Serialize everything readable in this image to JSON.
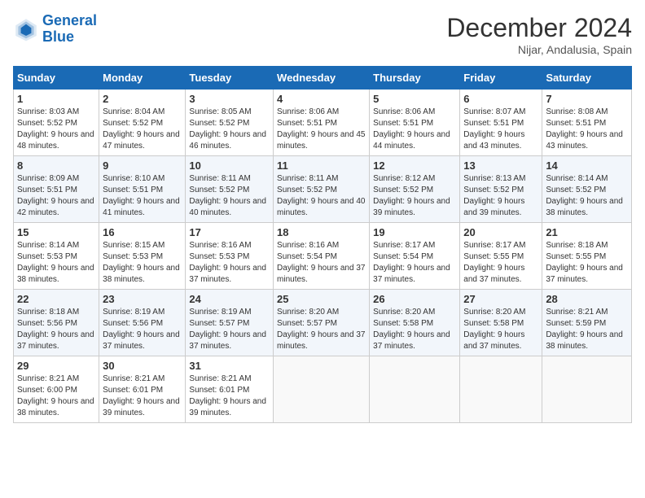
{
  "header": {
    "logo_line1": "General",
    "logo_line2": "Blue",
    "title": "December 2024",
    "subtitle": "Nijar, Andalusia, Spain"
  },
  "days_of_week": [
    "Sunday",
    "Monday",
    "Tuesday",
    "Wednesday",
    "Thursday",
    "Friday",
    "Saturday"
  ],
  "weeks": [
    [
      {
        "day": "1",
        "info": "Sunrise: 8:03 AM\nSunset: 5:52 PM\nDaylight: 9 hours and 48 minutes."
      },
      {
        "day": "2",
        "info": "Sunrise: 8:04 AM\nSunset: 5:52 PM\nDaylight: 9 hours and 47 minutes."
      },
      {
        "day": "3",
        "info": "Sunrise: 8:05 AM\nSunset: 5:52 PM\nDaylight: 9 hours and 46 minutes."
      },
      {
        "day": "4",
        "info": "Sunrise: 8:06 AM\nSunset: 5:51 PM\nDaylight: 9 hours and 45 minutes."
      },
      {
        "day": "5",
        "info": "Sunrise: 8:06 AM\nSunset: 5:51 PM\nDaylight: 9 hours and 44 minutes."
      },
      {
        "day": "6",
        "info": "Sunrise: 8:07 AM\nSunset: 5:51 PM\nDaylight: 9 hours and 43 minutes."
      },
      {
        "day": "7",
        "info": "Sunrise: 8:08 AM\nSunset: 5:51 PM\nDaylight: 9 hours and 43 minutes."
      }
    ],
    [
      {
        "day": "8",
        "info": "Sunrise: 8:09 AM\nSunset: 5:51 PM\nDaylight: 9 hours and 42 minutes."
      },
      {
        "day": "9",
        "info": "Sunrise: 8:10 AM\nSunset: 5:51 PM\nDaylight: 9 hours and 41 minutes."
      },
      {
        "day": "10",
        "info": "Sunrise: 8:11 AM\nSunset: 5:52 PM\nDaylight: 9 hours and 40 minutes."
      },
      {
        "day": "11",
        "info": "Sunrise: 8:11 AM\nSunset: 5:52 PM\nDaylight: 9 hours and 40 minutes."
      },
      {
        "day": "12",
        "info": "Sunrise: 8:12 AM\nSunset: 5:52 PM\nDaylight: 9 hours and 39 minutes."
      },
      {
        "day": "13",
        "info": "Sunrise: 8:13 AM\nSunset: 5:52 PM\nDaylight: 9 hours and 39 minutes."
      },
      {
        "day": "14",
        "info": "Sunrise: 8:14 AM\nSunset: 5:52 PM\nDaylight: 9 hours and 38 minutes."
      }
    ],
    [
      {
        "day": "15",
        "info": "Sunrise: 8:14 AM\nSunset: 5:53 PM\nDaylight: 9 hours and 38 minutes."
      },
      {
        "day": "16",
        "info": "Sunrise: 8:15 AM\nSunset: 5:53 PM\nDaylight: 9 hours and 38 minutes."
      },
      {
        "day": "17",
        "info": "Sunrise: 8:16 AM\nSunset: 5:53 PM\nDaylight: 9 hours and 37 minutes."
      },
      {
        "day": "18",
        "info": "Sunrise: 8:16 AM\nSunset: 5:54 PM\nDaylight: 9 hours and 37 minutes."
      },
      {
        "day": "19",
        "info": "Sunrise: 8:17 AM\nSunset: 5:54 PM\nDaylight: 9 hours and 37 minutes."
      },
      {
        "day": "20",
        "info": "Sunrise: 8:17 AM\nSunset: 5:55 PM\nDaylight: 9 hours and 37 minutes."
      },
      {
        "day": "21",
        "info": "Sunrise: 8:18 AM\nSunset: 5:55 PM\nDaylight: 9 hours and 37 minutes."
      }
    ],
    [
      {
        "day": "22",
        "info": "Sunrise: 8:18 AM\nSunset: 5:56 PM\nDaylight: 9 hours and 37 minutes."
      },
      {
        "day": "23",
        "info": "Sunrise: 8:19 AM\nSunset: 5:56 PM\nDaylight: 9 hours and 37 minutes."
      },
      {
        "day": "24",
        "info": "Sunrise: 8:19 AM\nSunset: 5:57 PM\nDaylight: 9 hours and 37 minutes."
      },
      {
        "day": "25",
        "info": "Sunrise: 8:20 AM\nSunset: 5:57 PM\nDaylight: 9 hours and 37 minutes."
      },
      {
        "day": "26",
        "info": "Sunrise: 8:20 AM\nSunset: 5:58 PM\nDaylight: 9 hours and 37 minutes."
      },
      {
        "day": "27",
        "info": "Sunrise: 8:20 AM\nSunset: 5:58 PM\nDaylight: 9 hours and 37 minutes."
      },
      {
        "day": "28",
        "info": "Sunrise: 8:21 AM\nSunset: 5:59 PM\nDaylight: 9 hours and 38 minutes."
      }
    ],
    [
      {
        "day": "29",
        "info": "Sunrise: 8:21 AM\nSunset: 6:00 PM\nDaylight: 9 hours and 38 minutes."
      },
      {
        "day": "30",
        "info": "Sunrise: 8:21 AM\nSunset: 6:01 PM\nDaylight: 9 hours and 39 minutes."
      },
      {
        "day": "31",
        "info": "Sunrise: 8:21 AM\nSunset: 6:01 PM\nDaylight: 9 hours and 39 minutes."
      },
      {
        "day": "",
        "info": ""
      },
      {
        "day": "",
        "info": ""
      },
      {
        "day": "",
        "info": ""
      },
      {
        "day": "",
        "info": ""
      }
    ]
  ]
}
